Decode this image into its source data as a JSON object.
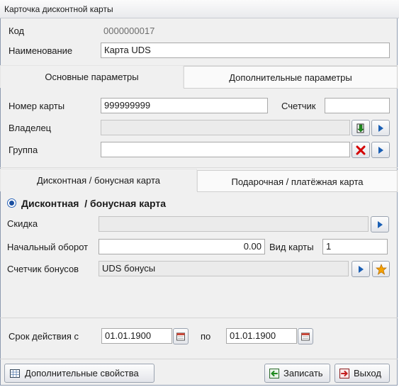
{
  "window": {
    "title": "Карточка дисконтной карты"
  },
  "code": {
    "label": "Код",
    "value": "0000000017"
  },
  "name": {
    "label": "Наименование",
    "value": "Карта UDS"
  },
  "tabs_main": [
    {
      "label": "Основные параметры",
      "active": true
    },
    {
      "label": "Дополнительные параметры",
      "active": false
    }
  ],
  "card_number": {
    "label": "Номер карты",
    "value": "999999999"
  },
  "counter": {
    "label": "Счетчик",
    "value": ""
  },
  "owner": {
    "label": "Владелец",
    "value": ""
  },
  "group": {
    "label": "Группа",
    "value": ""
  },
  "tabs_sub": [
    {
      "label": "Дисконтная / бонусная карта",
      "active": true
    },
    {
      "label": "Подарочная / платёжная карта",
      "active": false
    }
  ],
  "discount_radio": {
    "label": "Дисконтная  / бонусная карта",
    "selected": true
  },
  "discount": {
    "label": "Скидка",
    "value": ""
  },
  "initial_turnover": {
    "label": "Начальный оборот",
    "value": "0.00"
  },
  "card_type": {
    "label": "Вид карты",
    "value": "1"
  },
  "bonus_counter": {
    "label": "Счетчик бонусов",
    "value": "UDS бонусы"
  },
  "validity": {
    "label": "Срок действия с",
    "from": "01.01.1900",
    "to_label": "по",
    "to": "01.01.1900"
  },
  "buttons": {
    "extra_props": "Дополнительные свойства",
    "save": "Записать",
    "exit": "Выход"
  },
  "icons": {
    "arrow": "arrow-right-icon",
    "clear": "red-x-icon",
    "star": "star-icon",
    "calendar": "calendar-icon",
    "pick": "pick-document-icon"
  },
  "colors": {
    "accent": "#1a5fb4",
    "clear": "#d40000",
    "star": "#f5a100"
  }
}
